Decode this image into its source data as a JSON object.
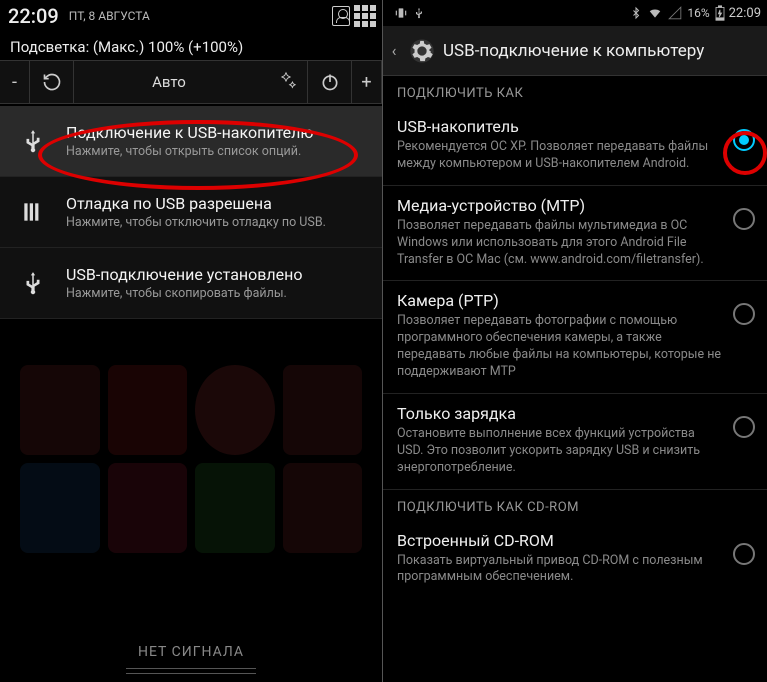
{
  "left": {
    "status": {
      "time": "22:09",
      "date": "ПТ, 8 АВГУСТА"
    },
    "backlight": "Подсветка: (Макс.) 100% (+100%)",
    "tools": {
      "minus": "-",
      "auto": "Авто",
      "plus": "+"
    },
    "notifications": [
      {
        "icon": "usb",
        "title": "Подключение к USB-накопителю",
        "sub": "Нажмите, чтобы открыть список опций."
      },
      {
        "icon": "bars",
        "title": "Отладка по USB разрешена",
        "sub": "Нажмите, чтобы отключить отладку по USB."
      },
      {
        "icon": "usb",
        "title": "USB-подключение установлено",
        "sub": "Нажмите, чтобы скопировать файлы."
      }
    ],
    "no_signal": "НЕТ СИГНАЛА"
  },
  "right": {
    "status": {
      "battery": "16%",
      "time": "22:09"
    },
    "header": "USB-подключение к компьютеру",
    "section1": "ПОДКЛЮЧИТЬ КАК",
    "options": [
      {
        "title": "USB-накопитель",
        "desc": "Рекомендуется ОС XP. Позволяет передавать файлы между компьютером и USB-накопителем Android.",
        "checked": true
      },
      {
        "title": "Медиа-устройство (MTP)",
        "desc": "Позволяет передавать файлы мультимедиа в ОС Windows или использовать для этого Android File Transfer в ОС Mac (см. www.android.com/filetransfer).",
        "checked": false
      },
      {
        "title": "Камера (PTP)",
        "desc": "Позволяет передавать фотографии с помощью программного обеспечения камеры, а также передавать любые файлы на компьютеры, которые не поддерживают MTP",
        "checked": false
      },
      {
        "title": "Только зарядка",
        "desc": "Остановите выполнение всех функций устройства USD. Это позволит ускорить зарядку USB и снизить энергопотребление.",
        "checked": false
      }
    ],
    "section2": "ПОДКЛЮЧИТЬ КАК CD-ROM",
    "options2": [
      {
        "title": "Встроенный CD-ROM",
        "desc": "Показать виртуальный привод CD-ROM с полезным программным обеспечением.",
        "checked": false
      }
    ]
  }
}
